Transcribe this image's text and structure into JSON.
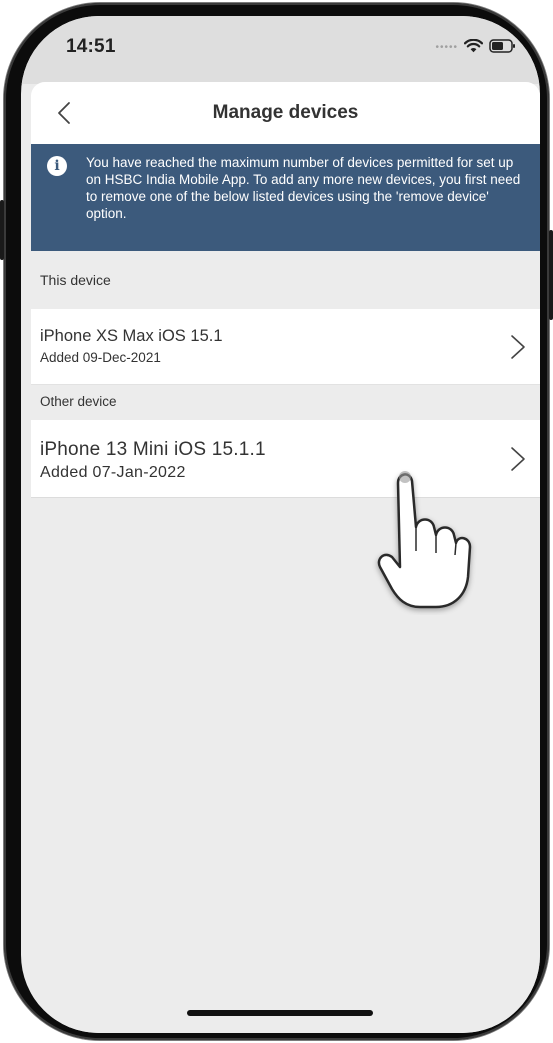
{
  "status_bar": {
    "time": "14:51",
    "icons": [
      "signal-dots-icon",
      "wifi-icon",
      "battery-icon"
    ]
  },
  "navbar": {
    "back_icon": "chevron-left-icon",
    "title": "Manage devices"
  },
  "info_banner": {
    "icon": "info-icon",
    "icon_glyph": "i",
    "message": "You have reached the maximum number of devices permitted for set up on HSBC India Mobile App. To add any more new devices, you first need to remove one of the below listed devices using the 'remove device' option."
  },
  "sections": {
    "this_device": {
      "header": "This device",
      "device": {
        "name": "iPhone XS Max iOS 15.1",
        "added": "Added 09-Dec-2021",
        "chevron_icon": "chevron-right-icon"
      }
    },
    "other_device": {
      "header": "Other device",
      "device": {
        "name": "iPhone 13 Mini iOS 15.1.1",
        "added": "Added 07-Jan-2022",
        "chevron_icon": "chevron-right-icon"
      }
    }
  },
  "overlay": {
    "pointer_icon": "tap-hand-icon"
  },
  "colors": {
    "banner_background": "#3c5a7c",
    "page_background": "#ececec",
    "row_background": "#ffffff",
    "text": "#333333"
  }
}
